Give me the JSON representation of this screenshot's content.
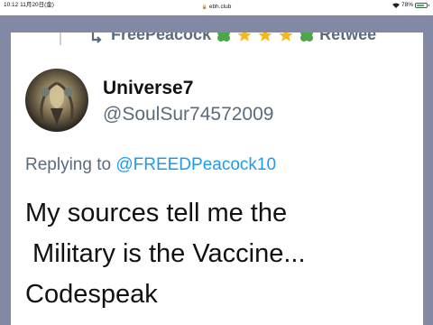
{
  "status_bar": {
    "time": "10:12",
    "date": "11月20日(金)",
    "url": "ebh.club",
    "battery_percent": "78%",
    "battery_level": 0.78,
    "battery_color": "#3cc24a"
  },
  "retweet_row": {
    "text": "FreePeacock",
    "retweet_label": "Retwee",
    "icons": [
      "retweet-icon",
      "clover-icon",
      "star-icon",
      "star-icon",
      "star-icon",
      "clover-icon"
    ]
  },
  "tweet": {
    "user_name": "Universe7",
    "user_handle": "@SoulSur74572009",
    "replying_prefix": "Replying to ",
    "replying_to": "@FREEDPeacock10",
    "text_lines": [
      "My sources tell me the",
      " Military is the Vaccine...",
      "Codespeak"
    ]
  },
  "colors": {
    "frame": "#8389a5",
    "mention": "#1d9bf0",
    "secondary_text": "#5b6b7c"
  }
}
